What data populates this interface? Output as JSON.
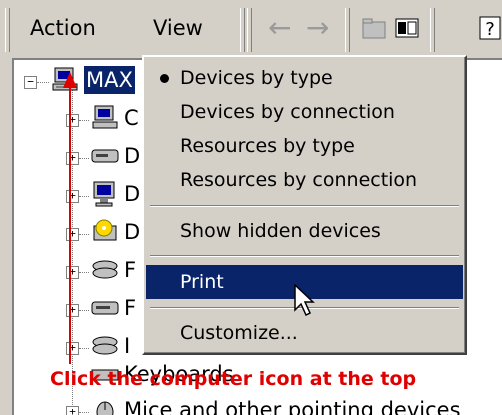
{
  "menubar": {
    "action_label": "Action",
    "view_label": "View",
    "toolbar_icons": [
      "back-arrow-icon",
      "forward-arrow-icon",
      "folder-up-icon",
      "properties-icon",
      "help-icon"
    ]
  },
  "tree": {
    "root_label": "MAX",
    "items": [
      {
        "label": "C",
        "icon": "computer-icon"
      },
      {
        "label": "D",
        "icon": "disk-drive-icon"
      },
      {
        "label": "D",
        "icon": "display-icon"
      },
      {
        "label": "D",
        "icon": "dvd-icon"
      },
      {
        "label": "F",
        "icon": "floppy-icon"
      },
      {
        "label": "F",
        "icon": "floppy-drive-icon"
      },
      {
        "label": "I",
        "icon": "controller-icon"
      },
      {
        "label": "Keyboards",
        "icon": "keyboard-icon"
      },
      {
        "label": "Mice and other pointing devices",
        "icon": "mouse-icon"
      }
    ]
  },
  "annotation": {
    "text": "Click the computer icon at the top",
    "color": "#e00000"
  },
  "popup_menu": {
    "items": [
      {
        "label": "Devices by type",
        "checked": true
      },
      {
        "label": "Devices by connection",
        "checked": false
      },
      {
        "label": "Resources by type",
        "checked": false
      },
      {
        "label": "Resources by connection",
        "checked": false
      },
      {
        "label": "Show hidden devices",
        "checked": false
      },
      {
        "label": "Print",
        "checked": false,
        "highlighted": true
      },
      {
        "label": "Customize...",
        "checked": false
      }
    ]
  },
  "colors": {
    "face": "#d4d0c8",
    "highlight": "#0a246a",
    "callout": "#e00000"
  }
}
